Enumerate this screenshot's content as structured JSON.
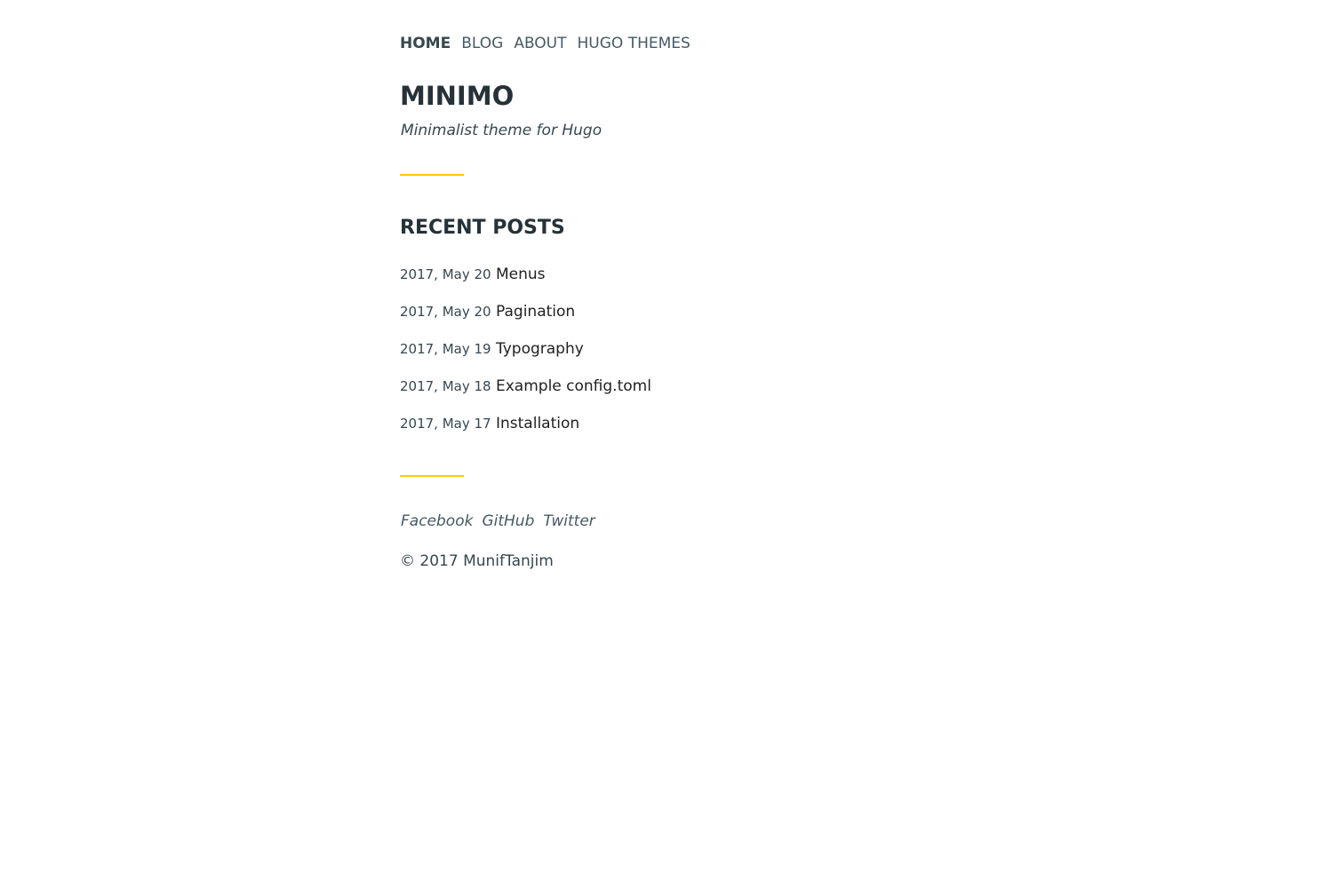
{
  "nav": {
    "items": [
      {
        "label": "HOME",
        "active": true
      },
      {
        "label": "BLOG",
        "active": false
      },
      {
        "label": "ABOUT",
        "active": false
      },
      {
        "label": "HUGO THEMES",
        "active": false
      }
    ]
  },
  "header": {
    "title": "MINIMO",
    "description": "Minimalist theme for Hugo"
  },
  "recent_posts": {
    "heading": "RECENT POSTS",
    "items": [
      {
        "date": "2017, May 20",
        "title": "Menus"
      },
      {
        "date": "2017, May 20",
        "title": "Pagination"
      },
      {
        "date": "2017, May 19",
        "title": "Typography"
      },
      {
        "date": "2017, May 18",
        "title": "Example config.toml"
      },
      {
        "date": "2017, May 17",
        "title": "Installation"
      }
    ]
  },
  "footer": {
    "social": [
      "Facebook",
      "GitHub",
      "Twitter"
    ],
    "copyright": "© 2017 MunifTanjim"
  },
  "colors": {
    "accent": "#ffcd00",
    "text": "#263238",
    "muted": "#455a64"
  }
}
